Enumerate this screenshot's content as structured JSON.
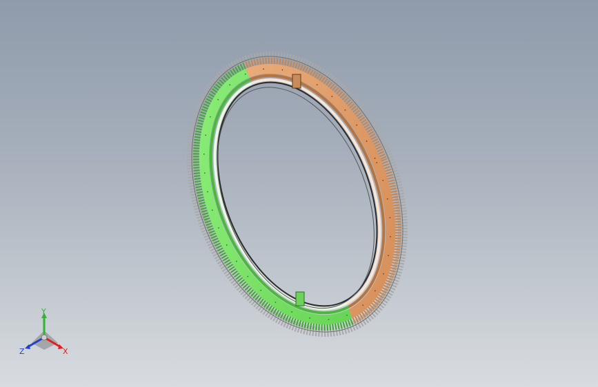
{
  "viewport": {
    "background_top": "#8f9bab",
    "background_bottom": "#d8dce0"
  },
  "model": {
    "name": "slewing-ring-gear",
    "segments": [
      {
        "name": "left-segment",
        "color": "#7ee06a"
      },
      {
        "name": "right-segment",
        "color": "#e8a974"
      }
    ],
    "teeth_color": "#b9b9b9"
  },
  "triad": {
    "x_label": "X",
    "y_label": "Y",
    "z_label": "Z",
    "x_color": "#e01e1e",
    "y_color": "#2fb52f",
    "z_color": "#2040d0"
  }
}
